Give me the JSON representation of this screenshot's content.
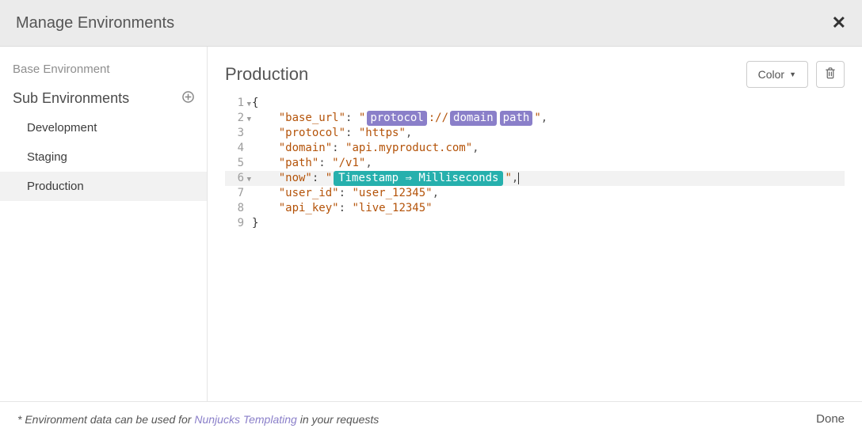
{
  "header": {
    "title": "Manage Environments"
  },
  "sidebar": {
    "base_label": "Base Environment",
    "sub_label": "Sub Environments",
    "items": [
      {
        "label": "Development"
      },
      {
        "label": "Staging"
      },
      {
        "label": "Production"
      }
    ]
  },
  "content": {
    "title": "Production",
    "color_button": "Color"
  },
  "editor": {
    "lines": [
      "1",
      "2",
      "3",
      "4",
      "5",
      "6",
      "7",
      "8",
      "9"
    ],
    "keys": {
      "base_url": "\"base_url\"",
      "protocol": "\"protocol\"",
      "domain": "\"domain\"",
      "path": "\"path\"",
      "now": "\"now\"",
      "user_id": "\"user_id\"",
      "api_key": "\"api_key\""
    },
    "values": {
      "protocol": "\"https\"",
      "domain": "\"api.myproduct.com\"",
      "path": "\"/v1\"",
      "user_id": "\"user_12345\"",
      "api_key": "\"live_12345\""
    },
    "tags": {
      "protocol": "protocol",
      "sep": "://",
      "domain": "domain",
      "path": "path",
      "timestamp": "Timestamp ⇒ Milliseconds"
    }
  },
  "footer": {
    "prefix": "* Environment data can be used for ",
    "link": "Nunjucks Templating",
    "suffix": " in your requests",
    "done": "Done"
  }
}
